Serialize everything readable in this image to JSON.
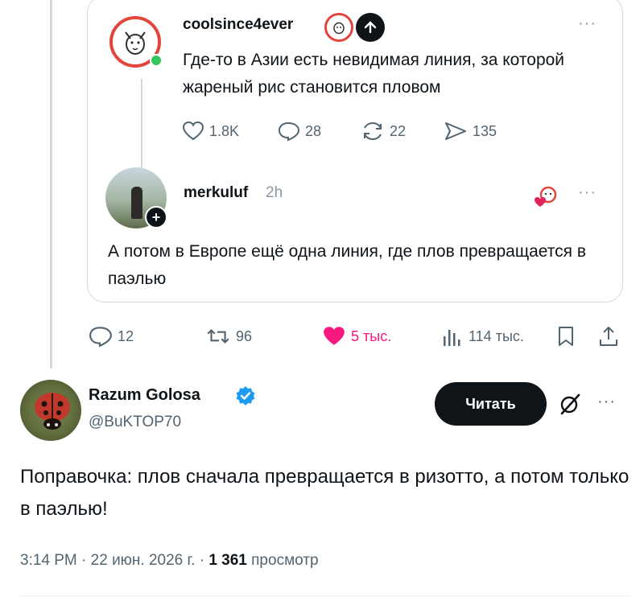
{
  "quoted": {
    "username": "coolsince4ever",
    "text": "Где-то в Азии есть невидимая линия, за которой жареный рис становится пловом",
    "likes": "1.8K",
    "replies": "28",
    "reposts": "22",
    "views": "135",
    "more": "···"
  },
  "reply": {
    "username": "merkuluf",
    "time": "2h",
    "text": "А потом в Европе ещё одна линия, где плов превращается в паэлью",
    "more": "···"
  },
  "main_actions": {
    "replies": "12",
    "reposts": "96",
    "likes": "5 тыс.",
    "views": "114 тыс.",
    "like_color": "#f91880"
  },
  "post": {
    "name": "Razum Golosa",
    "handle": "@BuKTOP70",
    "read_button": "Читать",
    "more": "···",
    "text": "Поправочка: плов сначала превращается в ризотто, а потом только в паэлью!",
    "time": "3:14 PM",
    "date": "22 июн. 2026 г.",
    "views_count": "1 361",
    "views_label": "просмотр",
    "sep": "·"
  },
  "colors": {
    "brand_red": "#e0463c",
    "online": "#35c55b",
    "verified": "#1d9bf0"
  }
}
